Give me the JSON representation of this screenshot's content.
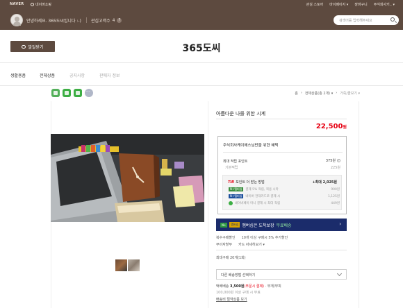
{
  "topbar": {
    "naver": "NAVER",
    "shopping": "네이버쇼핑",
    "links": [
      "관심 스토어",
      "마이페이지 ▾",
      "장바구니",
      "주식회사키.. ▾"
    ]
  },
  "header": {
    "greeting": "안녕하세요. 365도씨입니다 :-)",
    "favorite_label": "관심고객수",
    "favorite_count": "4",
    "search_placeholder": "검색어를 입력해주세요"
  },
  "store": {
    "talk_label": "말알받기",
    "name": "365도씨"
  },
  "nav": {
    "tabs": [
      "생활용품",
      "전체상품",
      "공지사항",
      "판매자 정보"
    ]
  },
  "breadcrumb": [
    "홈",
    "전체상품(총 2개) ▾",
    "가죽/클보기 ▾"
  ],
  "product": {
    "title": "아름다운 나를 위한 시계",
    "price": "22,500",
    "price_unit": "원"
  },
  "benefit": {
    "title": "주식회사케이에스님만을 위한 혜택",
    "max_point_label": "최대 적립 포인트",
    "max_point_value": "375원",
    "basic_label": "기본적립",
    "basic_value": "225원",
    "tip_prefix": "TIP.",
    "tip_label": "포인트 더 받는 방법",
    "tip_value": "+최대 2,025원",
    "tip_rows": [
      {
        "badge": "N+멤버십",
        "text": "결제 5% 적립, 적용 시마",
        "value": "900원"
      },
      {
        "badge": "N+멤버십",
        "text": "네이버 현대카드로 결제 시",
        "value": "1,125원"
      },
      {
        "badge": "",
        "text": "네이버페이 머니 결제 시 최대 적립",
        "value": "449원"
      }
    ]
  },
  "membership": {
    "badge1": "N+",
    "badge2": "멤버십",
    "text": "멤버십은 도착보장",
    "highlight": "무료배송",
    "arrow": "›"
  },
  "info": {
    "multi_label": "복수구매할인",
    "multi_value": "10개 이상 구매시 5% 추가할인",
    "interest_label": "무이자할부",
    "interest_value": "카드 자세히보기 ▾",
    "max_buy": "최대구매 20개(1회)"
  },
  "shipping": {
    "select_label": "다른 배송방법 선택하기",
    "fee_label": "택배배송",
    "fee_value": "3,500원",
    "fee_note": "(주문시 결제)",
    "fee_extra": "· 무게/부피",
    "condition": "100,000원 이상 구매 시 무료",
    "link": "배송비 절약상품 보기"
  }
}
